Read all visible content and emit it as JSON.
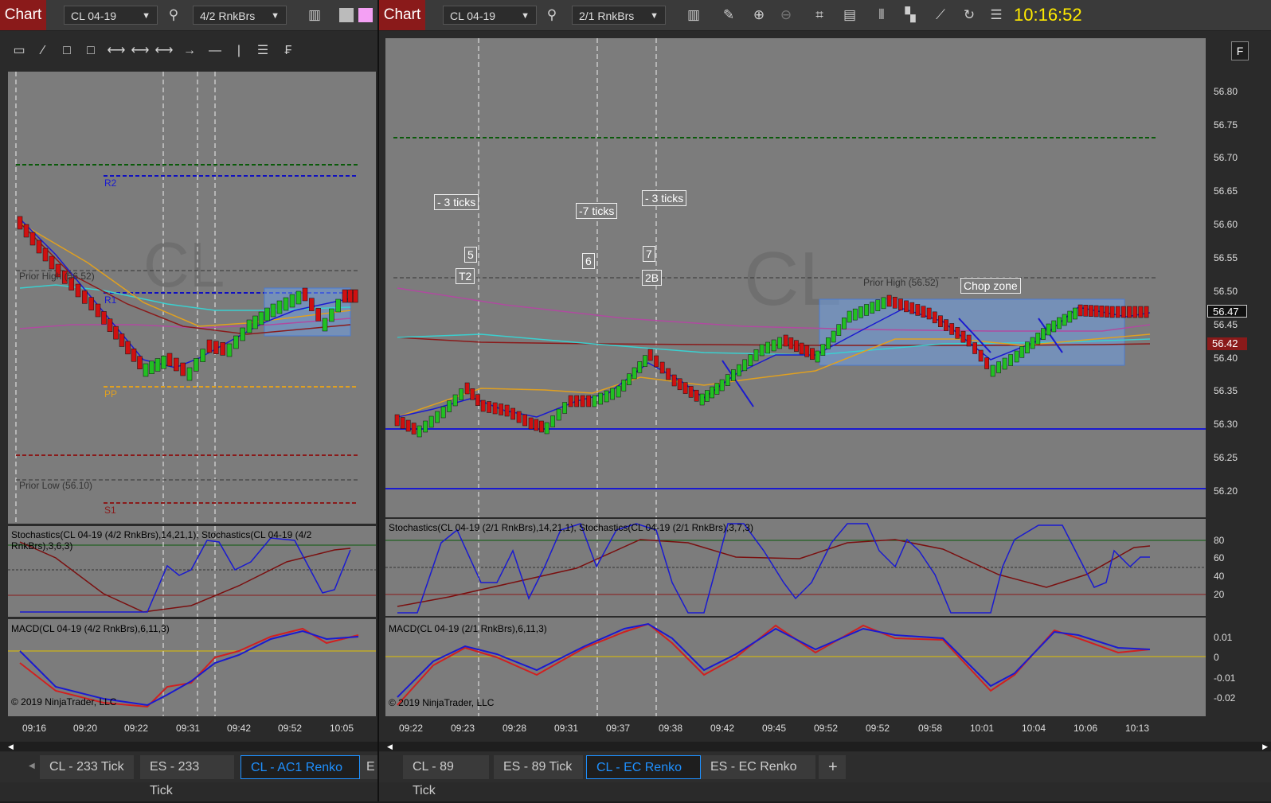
{
  "left": {
    "chart_button": "Chart",
    "instrument": "CL 04-19",
    "bar_type": "4/2 RnkBrs",
    "stoch_label": "Stochastics(CL 04-19 (4/2 RnkBrs),14,21,1), Stochastics(CL 04-19 (4/2 RnkBrs),3,6,3)",
    "macd_label": "MACD(CL 04-19 (4/2 RnkBrs),6,11,3)",
    "copyright": "© 2019 NinjaTrader, LLC",
    "watermark": "CL",
    "levels": {
      "r2": "R2",
      "r1": "R1",
      "pp": "PP",
      "s1": "S1",
      "prior_high": "Prior High (56.52)",
      "prior_low": "Prior Low (56.10)"
    },
    "x_ticks": [
      "09:16",
      "09:20",
      "09:22",
      "09:31",
      "09:42",
      "09:52",
      "10:05"
    ],
    "tabs": [
      "CL - 233 Tick",
      "ES - 233 Tick",
      "CL - AC1 Renko",
      "E"
    ]
  },
  "right": {
    "chart_button": "Chart",
    "instrument": "CL 04-19",
    "bar_type": "2/1 RnkBrs",
    "clock": "10:16:52",
    "stoch_label": "Stochastics(CL 04-19 (2/1 RnkBrs),14,21,1), Stochastics(CL 04-19 (2/1 RnkBrs),3,7,3)",
    "macd_label": "MACD(CL 04-19 (2/1 RnkBrs),6,11,3)",
    "copyright": "© 2019 NinjaTrader, LLC",
    "watermark": "CL",
    "prior_high": "Prior High (56.52)",
    "chop_zone": "Chop zone",
    "annotations": {
      "a1": "- 3 ticks",
      "a2": "-7 ticks",
      "a3": "- 3 ticks",
      "n5": "5",
      "n6": "6",
      "n7": "7",
      "t2": "T2",
      "b2": "2B"
    },
    "y_ticks": [
      "56.80",
      "56.75",
      "56.70",
      "56.65",
      "56.60",
      "56.55",
      "56.50",
      "56.45",
      "56.40",
      "56.35",
      "56.30",
      "56.25",
      "56.20"
    ],
    "price_last": "56.47",
    "price_other": "56.42",
    "stoch_ticks": [
      "80",
      "60",
      "40",
      "20"
    ],
    "macd_ticks": [
      "0.01",
      "0",
      "-0.01",
      "-0.02"
    ],
    "x_ticks": [
      "09:22",
      "09:23",
      "09:28",
      "09:31",
      "09:37",
      "09:38",
      "09:42",
      "09:45",
      "09:52",
      "09:52",
      "09:58",
      "10:01",
      "10:04",
      "10:06",
      "10:13"
    ],
    "tabs": [
      "CL - 89 Tick",
      "ES - 89 Tick",
      "CL - EC Renko",
      "ES - EC Renko",
      "+"
    ],
    "f_label": "F"
  },
  "colors": {
    "chart_red": "#8a1a1a",
    "clock": "#ffea00",
    "tab_active": "#1e90ff",
    "plot_bg": "#7c7c7c"
  }
}
